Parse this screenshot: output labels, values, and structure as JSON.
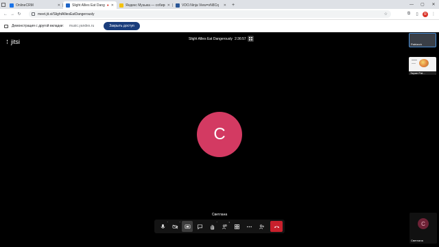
{
  "browser": {
    "tabs": [
      {
        "title": "OnlineCRM",
        "favicon_color": "#1a73e8",
        "active": false
      },
      {
        "title": "Slight Allies Eat Dangerously",
        "favicon_color": "#1f65c7",
        "active": true,
        "badge": "●"
      },
      {
        "title": "Яндекс Музыка — собирем...",
        "favicon_color": "#f4c20d",
        "active": false
      },
      {
        "title": "VDO.Ninja View=vN8Cq",
        "favicon_color": "#2b5797",
        "active": false
      }
    ],
    "new_tab": "+",
    "window_controls": {
      "minimize": "—",
      "maximize": "▢",
      "close": "✕"
    },
    "url": "meet.jit.si/SlightAlliesEatDangerously",
    "profile_initial": "R"
  },
  "share_bar": {
    "text": "Демонстрация с другой вкладки:",
    "domain": "music.yandex.ru",
    "stop_button": "Закрыть доступ"
  },
  "meeting": {
    "logo_text": "jitsi",
    "title": "Slight Allies Eat Dangerously",
    "timer": "2:36:57",
    "main_avatar_initial": "C",
    "speaker_name": "Светлана",
    "participants": [
      {
        "name": "Patriarch"
      },
      {
        "name": "Экран Pat..."
      }
    ],
    "self_view": {
      "initial": "C",
      "name": "Светлана"
    },
    "colors": {
      "avatar": "#d33a62",
      "hangup": "#c8202c",
      "accent": "#1a3d7c"
    }
  },
  "toolbar": {
    "items": [
      {
        "icon": "microphone-icon",
        "caret": "^"
      },
      {
        "icon": "camera-icon",
        "caret": "^"
      },
      {
        "icon": "screen-share-icon",
        "active": true
      },
      {
        "icon": "chat-icon"
      },
      {
        "icon": "raise-hand-icon",
        "caret": "^"
      },
      {
        "icon": "participants-icon",
        "count": "3"
      },
      {
        "icon": "tile-view-icon"
      },
      {
        "icon": "more-icon"
      },
      {
        "icon": "invite-icon"
      },
      {
        "icon": "hangup-icon"
      }
    ]
  }
}
